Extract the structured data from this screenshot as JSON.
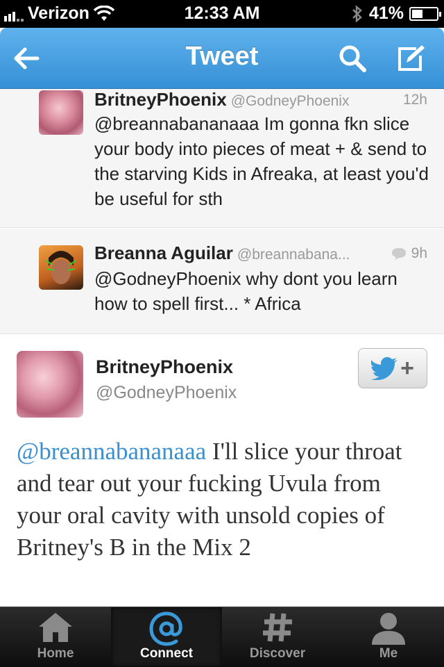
{
  "status_bar": {
    "carrier": "Verizon",
    "time": "12:33 AM",
    "battery": "41%",
    "battery_level": 0.41
  },
  "nav": {
    "title": "Tweet",
    "icons": [
      "back-arrow-icon",
      "search-icon",
      "compose-icon"
    ]
  },
  "replies": [
    {
      "name": "BritneyPhoenix",
      "handle": "@GodneyPhoenix",
      "time": "12h",
      "text": "@breannabananaaa Im gonna fkn slice your body into pieces of meat + & send to the starving Kids in Afreaka, at least you'd be useful for sth"
    },
    {
      "name": "Breanna Aguilar",
      "handle": "@breannabana...",
      "time": "9h",
      "text": "@GodneyPhoenix why dont you learn how to spell first... * Africa"
    }
  ],
  "main_tweet": {
    "name": "BritneyPhoenix",
    "handle": "@GodneyPhoenix",
    "mention": "@breannabananaaa",
    "text": " I'll slice your throat and tear out your fucking Uvula from your oral cavity with unsold copies of Britney's B in the Mix 2",
    "follow_label": "+"
  },
  "tabs": [
    {
      "label": "Home",
      "icon": "home-icon",
      "active": false
    },
    {
      "label": "Connect",
      "icon": "at-icon",
      "active": true
    },
    {
      "label": "Discover",
      "icon": "hash-icon",
      "active": false
    },
    {
      "label": "Me",
      "icon": "person-icon",
      "active": false
    }
  ],
  "colors": {
    "nav_blue": "#3590d6",
    "mention_blue": "#3a8fcf",
    "twitter_bird": "#3a9ad9"
  }
}
